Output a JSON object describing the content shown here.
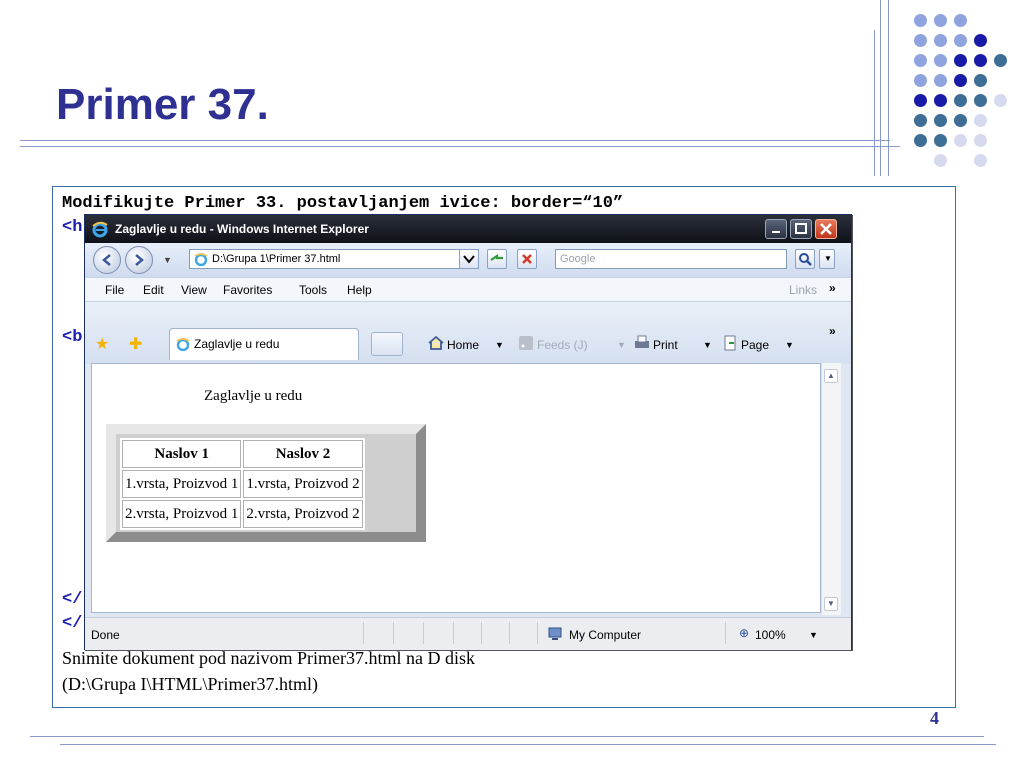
{
  "slide": {
    "title": "Primer 37.",
    "page_number": "4",
    "colors": {
      "title": "#2e3192",
      "border": "#3a6ea5"
    }
  },
  "content": {
    "instruction": "Modifikujte Primer 33. postavljanjem ivice: border=“10”",
    "code_fragments": [
      "<h",
      "<b",
      "</",
      "</"
    ],
    "note_line1": "Snimite dokument pod nazivom Primer37.html na D disk",
    "note_line2": "(D:\\Grupa I\\HTML\\Primer37.html)"
  },
  "browser": {
    "window_title": "Zaglavlje u redu - Windows Internet Explorer",
    "address": "D:\\Grupa 1\\Primer 37.html",
    "search_placeholder": "Google",
    "menu": [
      "File",
      "Edit",
      "View",
      "Favorites",
      "Tools",
      "Help"
    ],
    "links_label": "Links",
    "tab_title": "Zaglavlje u redu",
    "toolbar": {
      "home": "Home",
      "feeds": "Feeds (J)",
      "print": "Print",
      "page": "Page"
    },
    "status": {
      "text": "Done",
      "zone": "My Computer",
      "zoom": "100%"
    }
  },
  "page": {
    "caption": "Zaglavlje u redu",
    "table": {
      "headers": [
        "Naslov 1",
        "Naslov 2"
      ],
      "rows": [
        [
          "1.vrsta, Proizvod 1",
          "1.vrsta, Proizvod 2"
        ],
        [
          "2.vrsta, Proizvod 1",
          "2.vrsta, Proizvod 2"
        ]
      ],
      "border": "10"
    }
  }
}
